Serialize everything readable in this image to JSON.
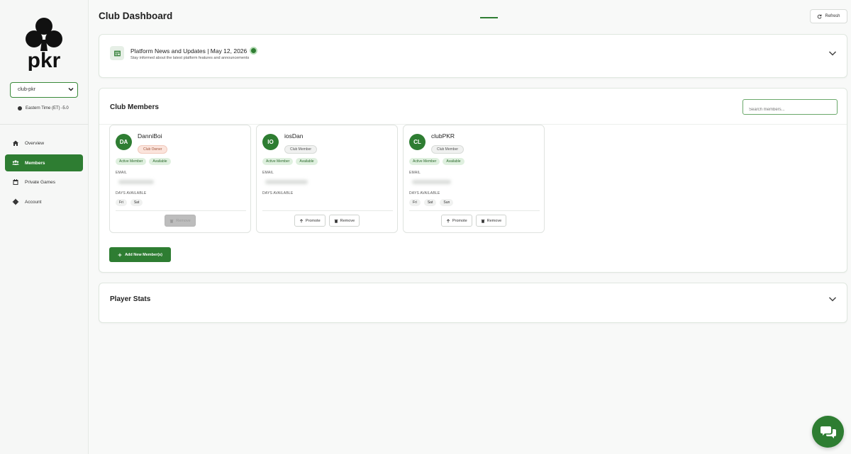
{
  "sidebar": {
    "logo_text": "pkr",
    "club_select": "club-pkr",
    "timezone": "Eastern Time (ET) -5.0",
    "nav": [
      {
        "label": "Overview",
        "icon": "home-icon"
      },
      {
        "label": "Members",
        "icon": "users-icon"
      },
      {
        "label": "Private Games",
        "icon": "calendar-icon"
      },
      {
        "label": "Account",
        "icon": "gear-icon"
      }
    ],
    "active_nav": "Members"
  },
  "header": {
    "title": "Club Dashboard",
    "refresh_label": "Refresh"
  },
  "news": {
    "title": "Platform News and Updates | May 12, 2026",
    "subtitle": "Stay informed about the latest platform features and announcements"
  },
  "members_section": {
    "title": "Club Members",
    "search_placeholder": "Search members...",
    "email_label": "EMAIL",
    "days_label": "DAYS AVAILABLE",
    "add_button": "Add New Member(s)",
    "members": [
      {
        "initials": "DA",
        "name": "DanniBoi",
        "role": "Club Owner",
        "tags": [
          "Active Member",
          "Available"
        ],
        "days": [
          "Fri",
          "Sat"
        ],
        "remove_label": "Remove"
      },
      {
        "initials": "IO",
        "name": "iosDan",
        "role": "Club Member",
        "tags": [
          "Active Member",
          "Available"
        ],
        "days": [],
        "promote_label": "Promote",
        "remove_label": "Remove"
      },
      {
        "initials": "CL",
        "name": "clubPKR",
        "role": "Club Member",
        "tags": [
          "Active Member",
          "Available"
        ],
        "days": [
          "Fri",
          "Sat",
          "Sun"
        ],
        "promote_label": "Promote",
        "remove_label": "Remove"
      }
    ]
  },
  "stats": {
    "title": "Player Stats"
  },
  "colors": {
    "accent": "#2e7d32",
    "owner_badge": "#fbe4dc",
    "tag_bg": "#dff0df"
  }
}
